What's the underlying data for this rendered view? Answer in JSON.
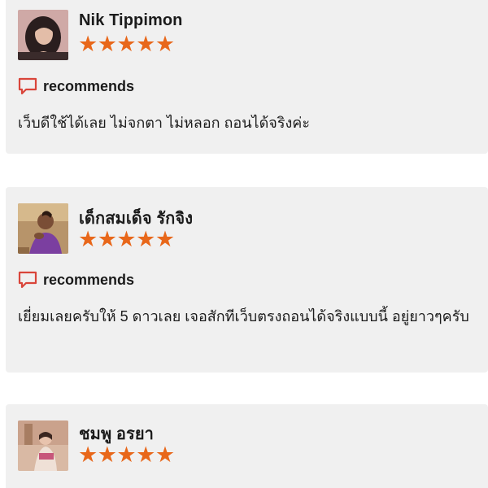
{
  "colors": {
    "star": "#e8671a",
    "recommend_icon": "#d9453a",
    "card_background": "#f0f0f0"
  },
  "reviews": [
    {
      "name": "Nik Tippimon",
      "stars": "★★★★★",
      "rating": 5,
      "recommend_label": "recommends",
      "recommend_icon": "speech-bubble-icon",
      "text": "เว็บดีใช้ได้เลย ไม่จกตา ไม่หลอก ถอนได้จริงค่ะ"
    },
    {
      "name": "เด็กสมเด็จ รักจิง",
      "stars": "★★★★★",
      "rating": 5,
      "recommend_label": "recommends",
      "recommend_icon": "speech-bubble-icon",
      "text": "เยี่ยมเลยครับให้ 5 ดาวเลย เจอสักทีเว็บตรงถอนได้จริงแบบนี้ อยู่ยาวๆครับ"
    },
    {
      "name": "ชมพู อรยา",
      "stars": "★★★★★",
      "rating": 5
    }
  ]
}
